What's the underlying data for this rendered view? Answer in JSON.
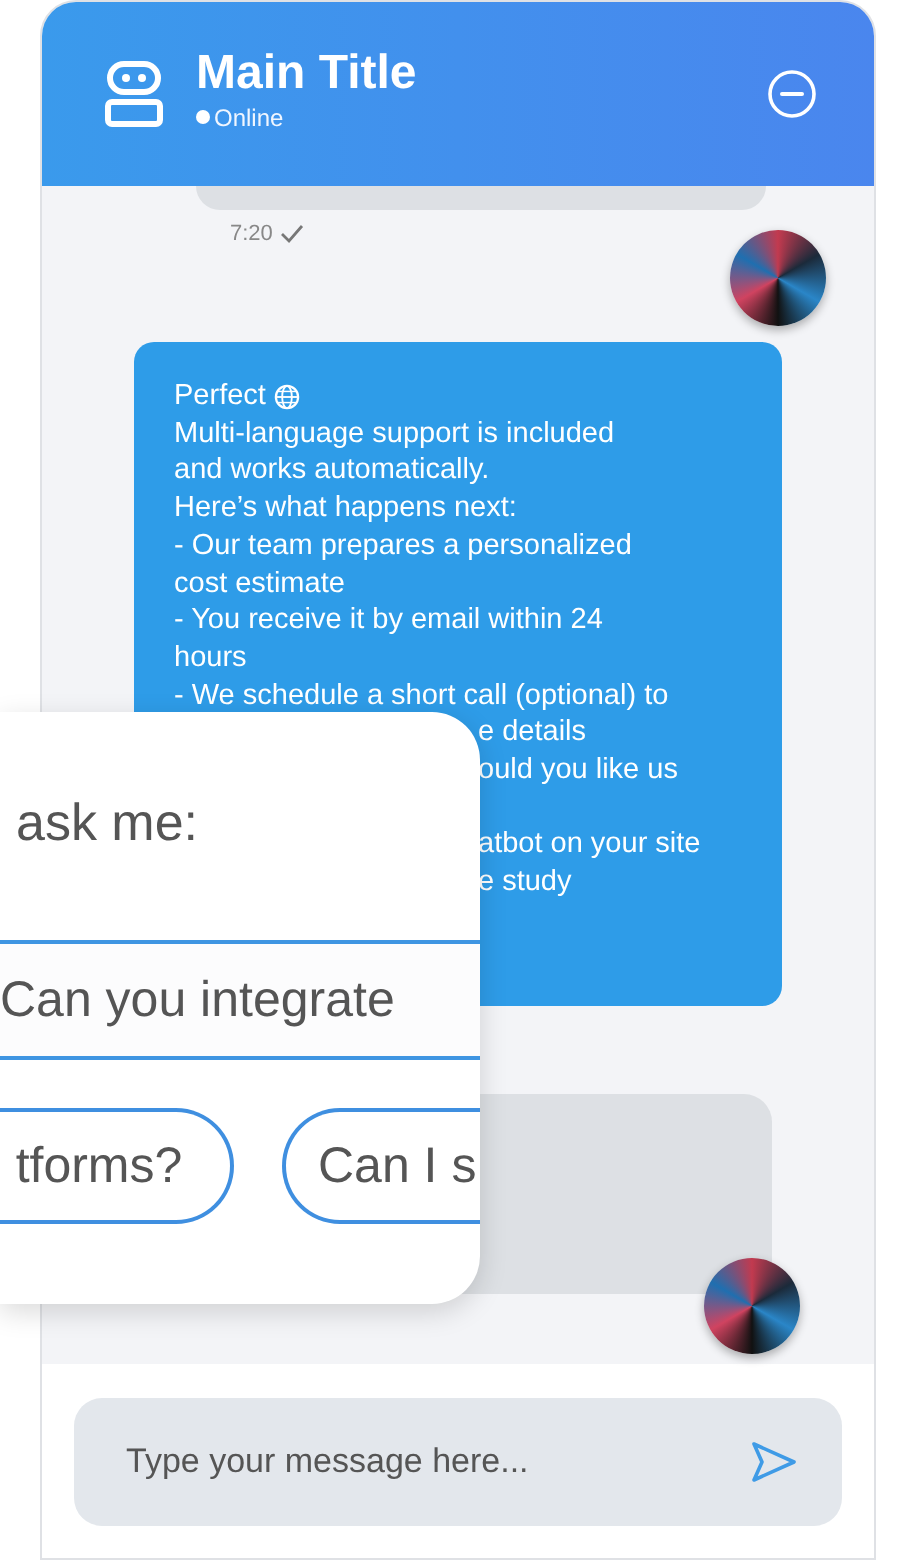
{
  "header": {
    "title": "Main Title",
    "status": "Online"
  },
  "messages": [
    {
      "kind": "bot",
      "time": "7:20",
      "read": true
    },
    {
      "kind": "user",
      "lines": [
        {
          "text": "Perfect",
          "covered": false,
          "gap_before": false
        },
        {
          "text": "Multi-language support is included",
          "covered": false,
          "gap_before": false
        },
        {
          "text": "and works automatically.",
          "covered": false,
          "gap_before": false
        },
        {
          "text": "Here’s what happens next:",
          "covered": false,
          "gap_before": false
        },
        {
          "text": "- Our team prepares a personalized",
          "covered": false,
          "gap_before": false
        },
        {
          "text": "cost estimate",
          "covered": false,
          "gap_before": false
        },
        {
          "text": "- You receive it by email within 24",
          "covered": false,
          "gap_before": false
        },
        {
          "text": "hours",
          "covered": false,
          "gap_before": false
        },
        {
          "text": "- We schedule a short call (optional) to",
          "covered": false,
          "gap_before": false
        },
        {
          "text": "e details",
          "covered": true,
          "gap_before": false
        },
        {
          "text": "ould you like us",
          "covered": true,
          "gap_before": false
        },
        {
          "text": "atbot on your site",
          "covered": true,
          "gap_before": true
        },
        {
          "text": "e study",
          "covered": true,
          "gap_before": false
        }
      ]
    },
    {
      "kind": "bot"
    }
  ],
  "suggestions": {
    "heading": "ask me:",
    "question": "Can you integrate",
    "chips": [
      "tforms?",
      "Can I s"
    ]
  },
  "composer": {
    "placeholder": "Type your message here..."
  }
}
